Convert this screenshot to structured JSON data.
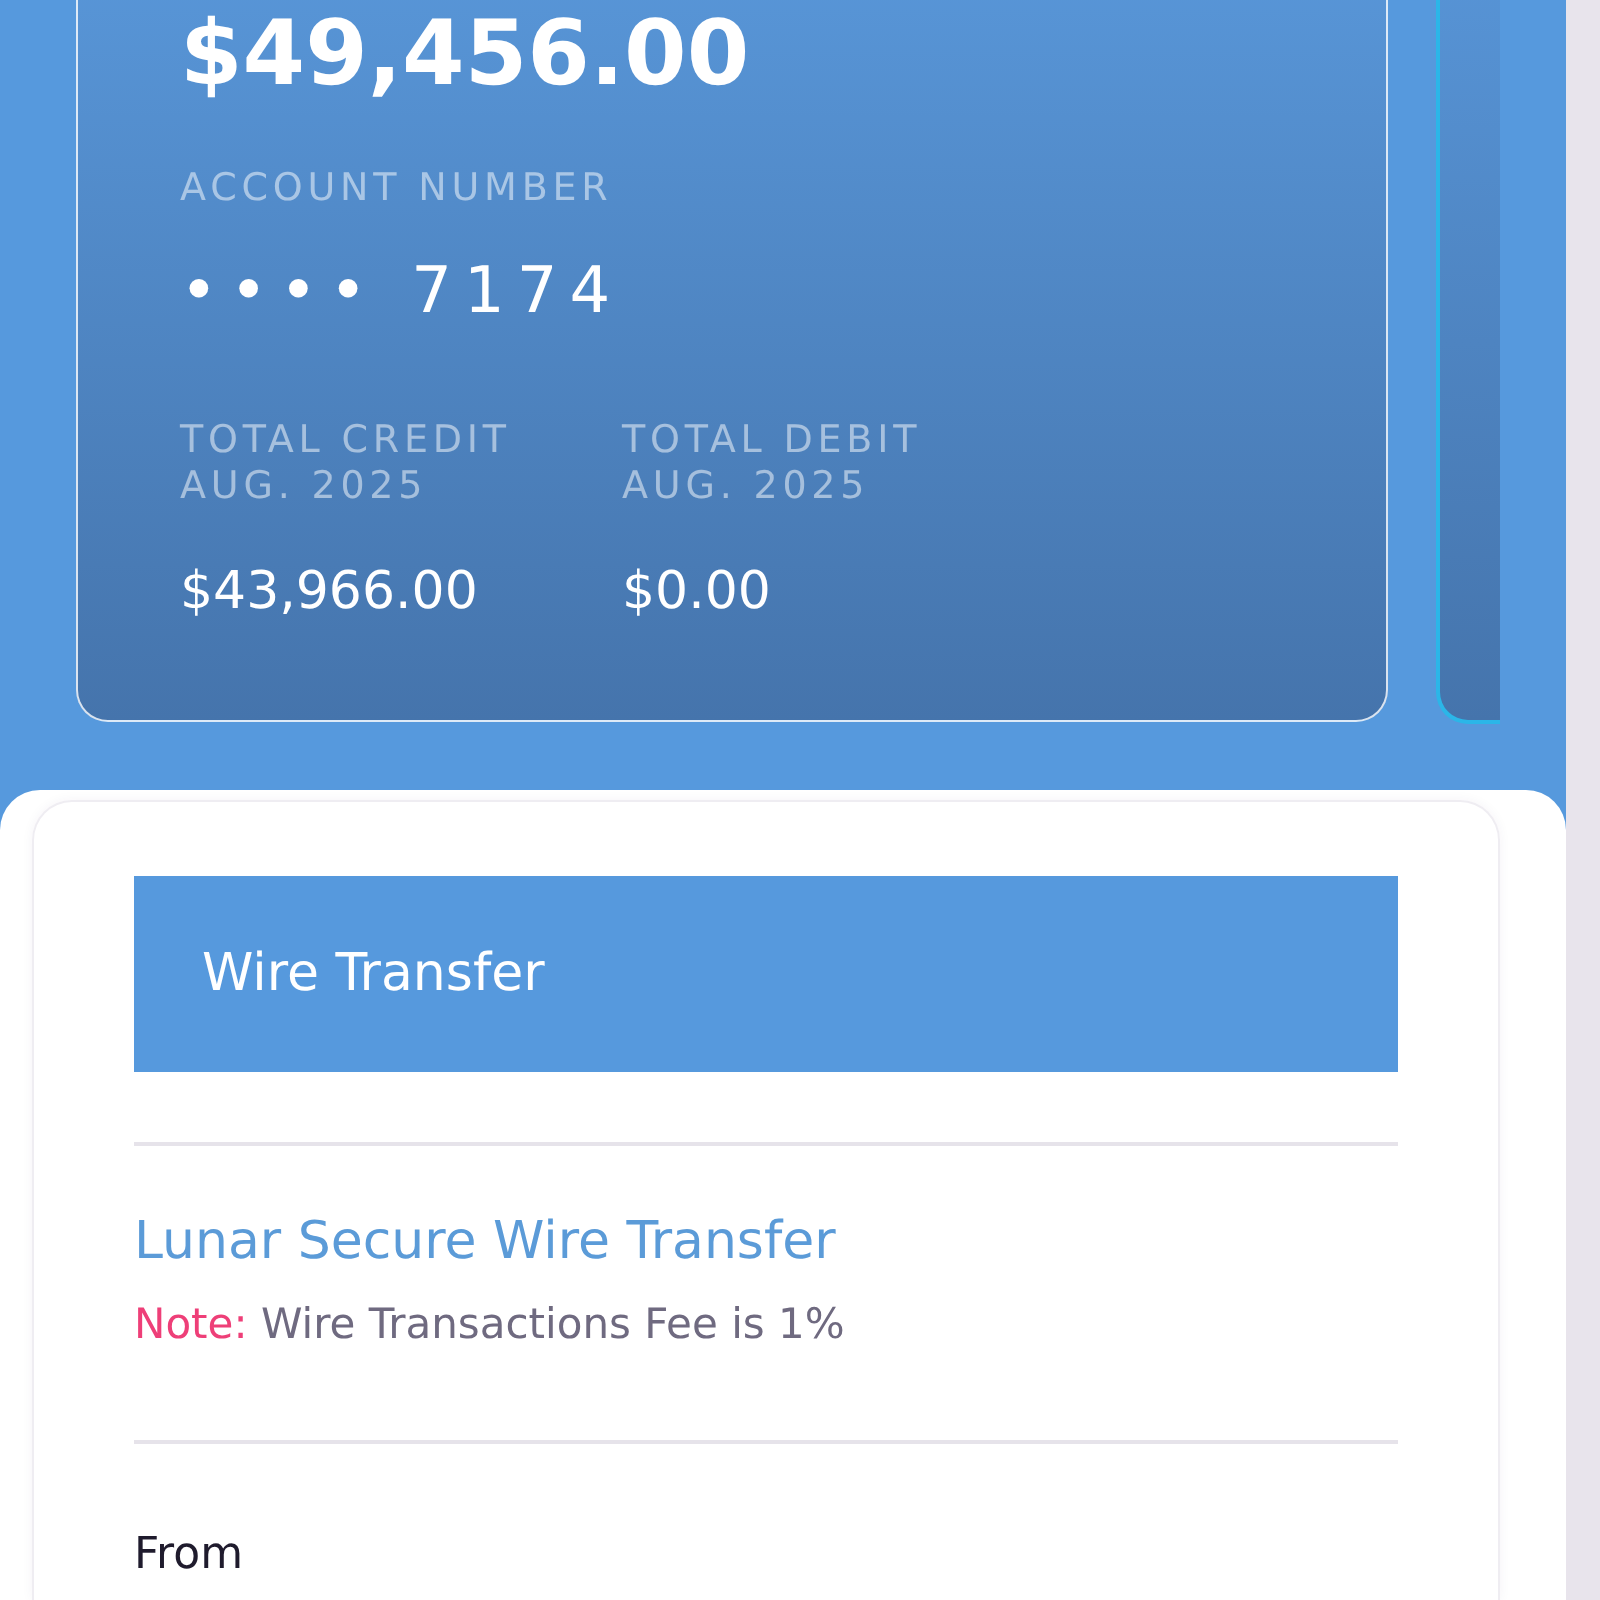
{
  "account_card": {
    "balance": "$49,456.00",
    "account_number_label": "ACCOUNT NUMBER",
    "account_number": "•••• 7174",
    "totals": [
      {
        "label": "TOTAL CREDIT",
        "period": "AUG. 2025",
        "amount": "$43,966.00"
      },
      {
        "label": "TOTAL DEBIT",
        "period": "AUG. 2025",
        "amount": "$0.00"
      }
    ]
  },
  "wire_transfer": {
    "header": "Wire Transfer",
    "title": "Lunar Secure Wire Transfer",
    "note_label": "Note:",
    "note": "Wire Transactions Fee is 1%",
    "from_label": "From"
  }
}
